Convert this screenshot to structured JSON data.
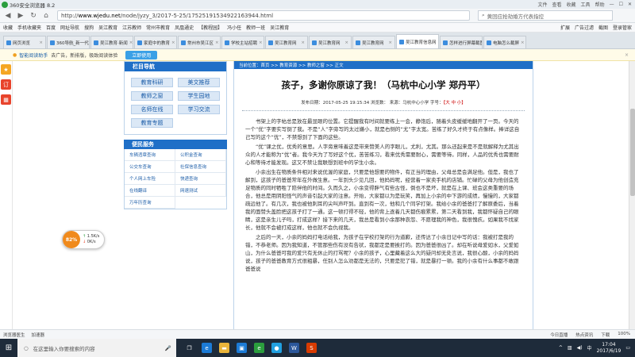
{
  "browser": {
    "title": "360安全浏览器 8.2",
    "title_controls": [
      "文件",
      "查看",
      "收藏",
      "工具",
      "帮助"
    ],
    "url_prefix": "http://",
    "url_host": "www.wjedu.net",
    "url_path": "/node/jyzy_3/2017-5-25/17525191534922163944.html",
    "search_text": "黄回应抢劫婚方代表指控",
    "favorites": [
      "收藏",
      "手机收藏夹",
      "百度",
      "网址导航",
      "搜狗",
      "吴江教育",
      "江苏教师",
      "常州市教育",
      "凤凰通史",
      "【教程园】",
      "冯小任",
      "教师一班",
      "吴江教育"
    ],
    "favorites_right": [
      "扩展",
      "广告过滤",
      "截图",
      "登录管家"
    ]
  },
  "tabs": [
    {
      "label": "网页浏览",
      "active": false
    },
    {
      "label": "360导航_新一代",
      "active": false
    },
    {
      "label": "吴江教育·新闻",
      "active": false
    },
    {
      "label": "家庭中的教育",
      "active": false
    },
    {
      "label": "常州市吴江区",
      "active": false
    },
    {
      "label": "学校主站招聘",
      "active": false
    },
    {
      "label": "吴江教育网",
      "active": false
    },
    {
      "label": "吴江教育网",
      "active": false
    },
    {
      "label": "吴江教育网",
      "active": false
    },
    {
      "label": "吴江教育信息网",
      "active": true
    },
    {
      "label": "怎样进行屏幕截图",
      "active": false
    },
    {
      "label": "电脑怎么截屏",
      "active": false
    }
  ],
  "notice": {
    "brand": "智能阅读助手",
    "text": "去广告，新排版，极致阅读体验",
    "button": "立即使用",
    "close": "×"
  },
  "leftrail": [
    {
      "icon": "star-icon",
      "glyph": "★",
      "color": "#f5a623"
    },
    {
      "icon": "news-icon",
      "glyph": "订",
      "color": "#e8442c"
    },
    {
      "icon": "grid-icon",
      "glyph": "▦",
      "color": "#e8442c"
    }
  ],
  "nav": {
    "header": "栏目导航",
    "items": [
      "教育科研",
      "美文推荐",
      "教师之窗",
      "学生园地",
      "名师在线",
      "学习交流",
      "教育专题"
    ]
  },
  "services": {
    "header": "便民服务",
    "items": [
      "车辆违章查询",
      "公积金查询",
      "公交车查询",
      "社保信息查询",
      "个人网上车险",
      "快递查询",
      "在线翻译",
      "网速测试",
      "万年历查询"
    ]
  },
  "article": {
    "breadcrumb": "当前位置：首页 >> 教育资源 >> 教师之窗 >> 正文",
    "title": "孩子，多谢你原谅了我！（马杭中心小学  郑丹平）",
    "meta_prefix": "发布日期：2017-05-25 19:15:34 浏览数：  来源：马杭中心小学 字号：",
    "meta_fontsize": "【大 中 小】",
    "paragraphs": [
      "书架上的字帖总是放在最显眼的位置。它提醒我有时间就要练上一会，静饱后，随着头皮缓缓地翻开了一页。今天的一个“优”字要实写倒了我。不是“人”字旁写的太过嫌小，就是右侧的“尤”字太宽。苦练了好久才终于有点像样。捧详这自己写的这个“优”，不禁想到了下面的这些。",
      "“优”课之优，优秀的意思。人字旁意味着这是带来赞美人的字眼儿，尤利，尤其。那么还起来是不是就解释为尤其出众的人才能称为“优”者。我今天为了写好这个优，苦苦练习，看来优秀需要耐心，需要等待。同样，人品的优秀也需要耐心和等待才能发现。这又不禁让我联想到班中的学生小余。",
      "小余出生在物质条件相对来说优渥的家庭，只要是他想要的物件，有正当的理由，父母总是会满足他。但是，我也了解到，这孩子的爸爸常年在外做生意。一年到头少见几回，他妈妈呢，经营着一家卖手机的店铺。忙碌的父母为他创造充足物质的同时牺牲了陪伴他的时间。久而久之，小余变得胖气有些古怪，倒也不是坏，就是在上课、班会这类重要的场合，他总是用阴阳怪气的声音引起大家的注意。开始，大家都以为是玩笑，再加上小余的中下游的成绩，慢慢的，大家都疏远他了。有几次，我也被他刺耳的尖叫声吓到。直到有一次，他和几个同学打架。我给小余的爸爸打了解原委后，当着我的面赞头盖脸把这孩子打了一通。这一顿打得不轻，他的背上逐着几天都伤痕累累，第二天看到我，我都怀疑自己的眼睛，这是亲生儿子吗，打成这样？接下来的几天，我总是看到小余那种哀怨、不愿理我的神色，我很愧疚。如果我不找家长，他就不会被打成这样，他也就不会仇视我。",
      "之后的一天，小余的妈妈打电话给我，为孩子在学校打架的行为道歉，还传达了小余日记中写的话：我被打是我的错，不恭老师。因为我知道，不管那些伤有没有告状，我都定是要挨打的。因为爸爸很凶了。却在听说母爱如水，父爱如山，为什么爸爸可我的爱只有无休止的打骂呢？小余的孩子，心里藏着这么大的疑问却无处言说，我很心酸，小余的妈妈说，孩子的爸爸教育方式很粗暴，任别人怎么劝都是无法的，只要是犯了错，就是暴打一顿。我的小余有什么事都不敢跟爸爸说"
    ]
  },
  "floatwidget": {
    "percent": "82%",
    "up": "1.5K/s",
    "down": "0K/s"
  },
  "statusbar": {
    "left": [
      "浏览器医生",
      "加速器"
    ],
    "right": [
      "今日直播",
      "热点资讯",
      "下载",
      "100%"
    ]
  },
  "taskbar": {
    "search_placeholder": "在这里输入你要搜索的内容",
    "time": "17:04",
    "date": "2017/6/19",
    "tray_lang": "中",
    "apps": [
      {
        "icon": "task-view-icon",
        "glyph": "❐",
        "color": "#1e2b3a"
      },
      {
        "icon": "edge-icon",
        "glyph": "e",
        "color": "#1c7bd6"
      },
      {
        "icon": "folder-icon",
        "glyph": "▬",
        "color": "#e9b43a"
      },
      {
        "icon": "store-icon",
        "glyph": "▣",
        "color": "#1c7bd6"
      },
      {
        "icon": "browser-360-icon",
        "glyph": "e",
        "color": "#2b9e3e"
      },
      {
        "icon": "qq-icon",
        "glyph": "●",
        "color": "#21a0e0"
      },
      {
        "icon": "word-icon",
        "glyph": "W",
        "color": "#2b579a"
      },
      {
        "icon": "app-icon",
        "glyph": "S",
        "color": "#d83b01"
      }
    ]
  }
}
